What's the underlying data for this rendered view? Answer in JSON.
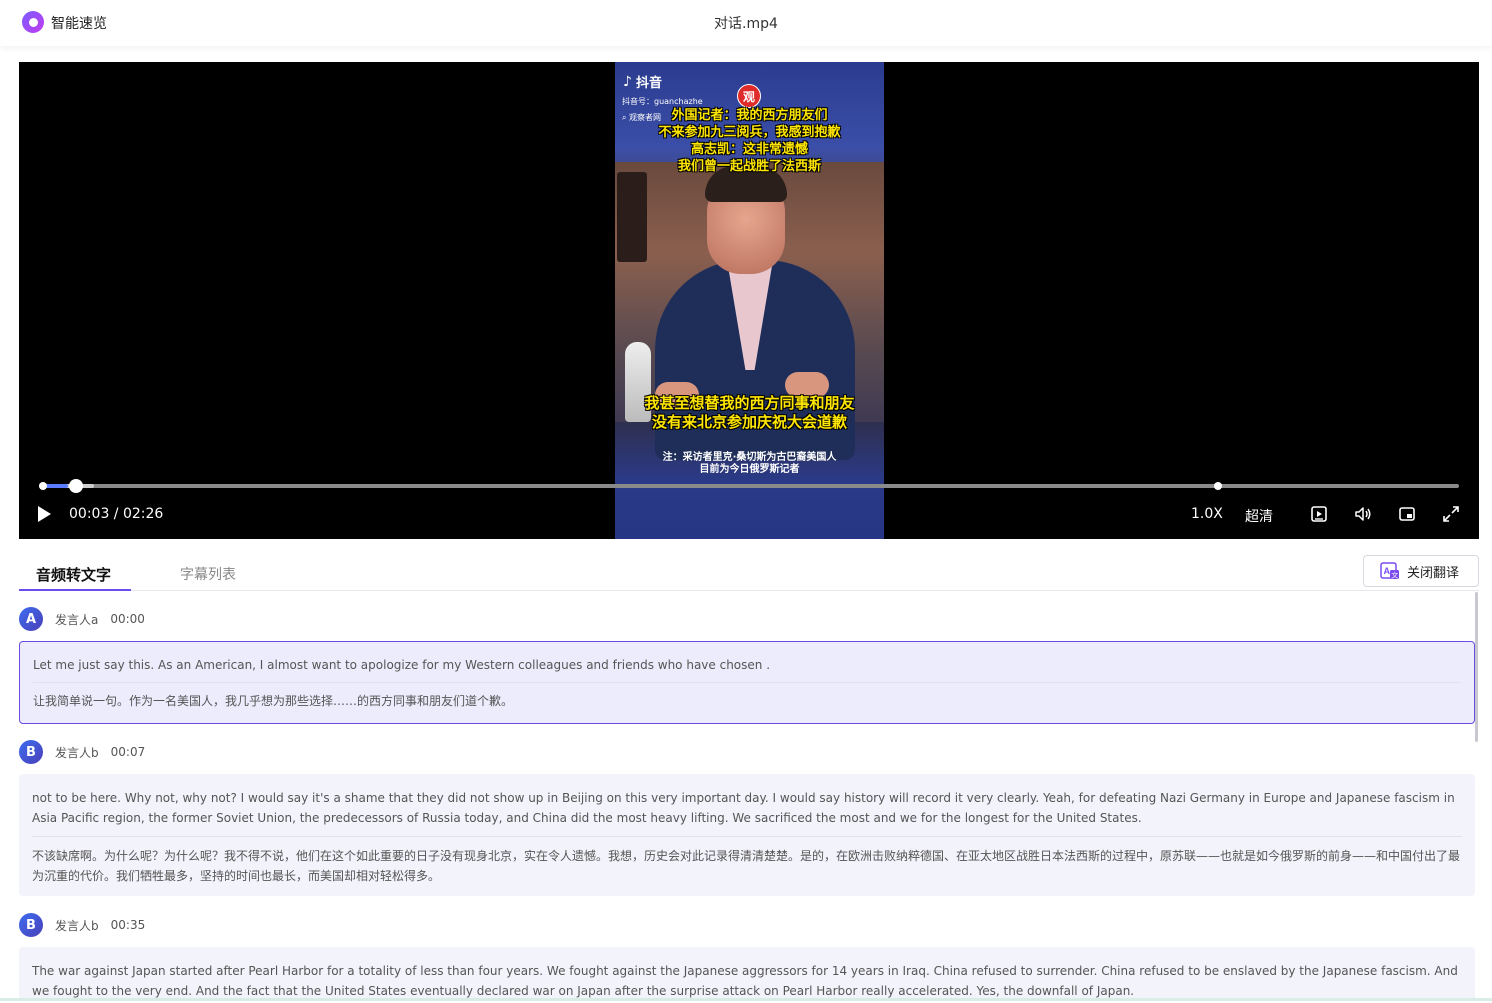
{
  "app": {
    "name": "智能速览",
    "file_title": "对话.mp4"
  },
  "video": {
    "tiktok_brand": "抖音",
    "douyin_id": "抖音号：guanchazhe",
    "search_label": "观察者网",
    "seal_char": "观",
    "caption_top": [
      "外国记者：我的西方朋友们",
      "不来参加九三阅兵，我感到抱歉",
      "高志凯：这非常遗憾",
      "我们曾一起战胜了法西斯"
    ],
    "caption_bottom": [
      "我甚至想替我的西方同事和朋友",
      "没有来北京参加庆祝大会道歉"
    ],
    "note": [
      "注：采访者里克·桑切斯为古巴裔美国人",
      "目前为今日俄罗斯记者"
    ]
  },
  "controls": {
    "time": "00:03 / 02:26",
    "current_seconds": 3,
    "duration_seconds": 146,
    "buffered_fraction": 0.039,
    "marker_fraction": 0.83,
    "speed": "1.0X",
    "quality": "超清",
    "icons": [
      "play-icon",
      "playlist-icon",
      "volume-icon",
      "picture-in-picture-icon",
      "fullscreen-icon"
    ]
  },
  "tabs": [
    {
      "label": "音频转文字",
      "active": true
    },
    {
      "label": "字幕列表",
      "active": false
    }
  ],
  "translate_button": {
    "label": "关闭翻译",
    "icon": "translate-icon"
  },
  "segments": [
    {
      "avatar": "A",
      "speaker": "发言人a",
      "time": "00:00",
      "active": true,
      "en": "Let me just say this. As an American, I almost want to apologize for my Western colleagues and friends who have chosen .",
      "zh": "让我简单说一句。作为一名美国人，我几乎想为那些选择……的西方同事和朋友们道个歉。"
    },
    {
      "avatar": "B",
      "speaker": "发言人b",
      "time": "00:07",
      "active": false,
      "en": "not to be here. Why not, why not? I would say it's a shame that they did not show up in Beijing on this very important day. I would say history will record it very clearly. Yeah, for defeating Nazi Germany in Europe and Japanese fascism in Asia Pacific region, the former Soviet Union, the predecessors of Russia today, and China did the most heavy lifting. We sacrificed the most and we for the longest for the United States.",
      "zh": "不该缺席啊。为什么呢？为什么呢？我不得不说，他们在这个如此重要的日子没有现身北京，实在令人遗憾。我想，历史会对此记录得清清楚楚。是的，在欧洲击败纳粹德国、在亚太地区战胜日本法西斯的过程中，原苏联——也就是如今俄罗斯的前身——和中国付出了最为沉重的代价。我们牺牲最多，坚持的时间也最长，而美国却相对轻松得多。"
    },
    {
      "avatar": "B",
      "speaker": "发言人b",
      "time": "00:35",
      "active": false,
      "en": "The war against Japan started after Pearl Harbor for a totality of less than four years. We fought against the Japanese aggressors for 14 years in Iraq. China refused to surrender. China refused to be enslaved by the Japanese fascism. And we fought to the very end. And the fact that the United States eventually declared war on Japan after the surprise attack on Pearl Harbor really accelerated. Yes, the downfall of Japan.",
      "zh": ""
    }
  ]
}
